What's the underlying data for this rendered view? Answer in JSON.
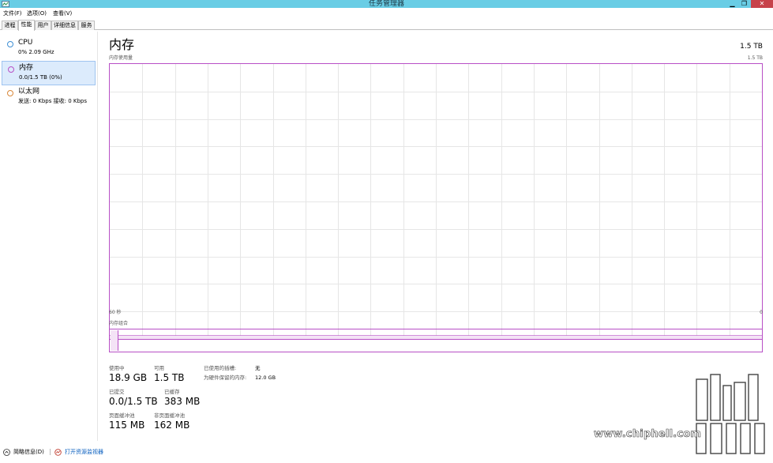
{
  "window": {
    "title": "任务管理器",
    "minimize": "▁",
    "maximize": "❐",
    "close": "✕"
  },
  "menu": [
    {
      "label": "文件(F)"
    },
    {
      "label": "选项(O)"
    },
    {
      "label": "查看(V)"
    }
  ],
  "tabs": [
    {
      "label": "进程"
    },
    {
      "label": "性能"
    },
    {
      "label": "用户"
    },
    {
      "label": "详细信息"
    },
    {
      "label": "服务"
    }
  ],
  "sidebar": {
    "items": [
      {
        "title": "CPU",
        "subtitle": "0% 2.09 GHz",
        "color": "#3f8fd4"
      },
      {
        "title": "内存",
        "subtitle": "0.0/1.5 TB (0%)",
        "color": "#b84fc6"
      },
      {
        "title": "以太网",
        "subtitle": "发送: 0 Kbps  接收: 0 Kbps",
        "color": "#d8883a"
      }
    ]
  },
  "main": {
    "title": "内存",
    "total": "1.5 TB",
    "graph": {
      "caption": "内存使用量",
      "max": "1.5 TB",
      "axis_left": "60 秒",
      "axis_right": "0"
    },
    "composition_caption": "内存组合",
    "accent_color": "#b84fc6"
  },
  "stats": {
    "in_use": {
      "label": "使用中",
      "value": "18.9 GB"
    },
    "available": {
      "label": "可用",
      "value": "1.5 TB"
    },
    "committed": {
      "label": "已提交",
      "value": "0.0/1.5 TB"
    },
    "cached": {
      "label": "已缓存",
      "value": "383 MB"
    },
    "paged_pool": {
      "label": "页面缓冲池",
      "value": "115 MB"
    },
    "nonpaged_pool": {
      "label": "非页面缓冲池",
      "value": "162 MB"
    },
    "slots_used": {
      "label": "已使用的插槽:",
      "value": "无"
    },
    "hardware_reserved": {
      "label": "为硬件保留的内存:",
      "value": "12.0 GB"
    }
  },
  "statusbar": {
    "summary": "简略信息(D)",
    "open_monitor": "打开资源监视器"
  },
  "watermark": {
    "text": "www.chiphell.com"
  }
}
